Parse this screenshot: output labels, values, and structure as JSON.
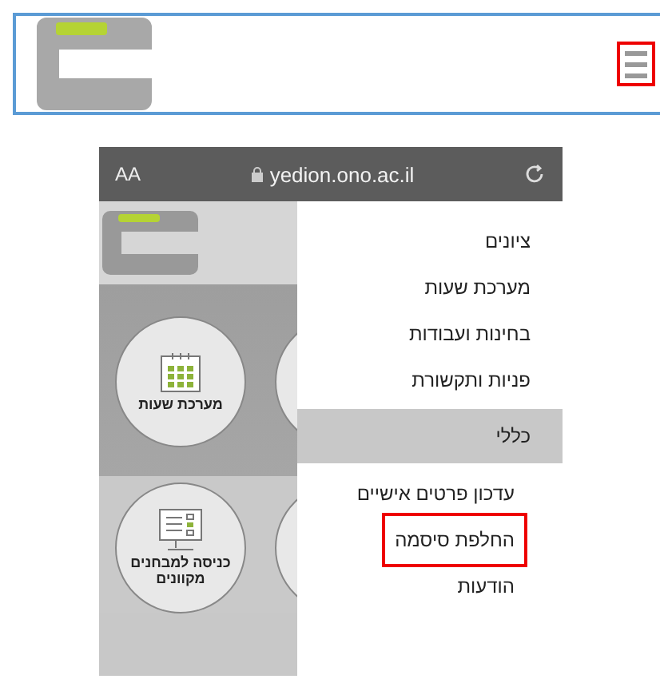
{
  "header": {
    "menu_button": {
      "outlined": true
    }
  },
  "browser": {
    "text_size_button": "AA",
    "url": "yedion.ono.ac.il"
  },
  "tiles": [
    {
      "label": "מערכת שעות",
      "kind": "calendar"
    },
    {
      "kind": "blank"
    },
    {
      "label": "כניסה למבחנים מקוונים",
      "kind": "exam"
    },
    {
      "kind": "blank"
    }
  ],
  "menu": [
    {
      "label": "ציונים",
      "selected": false,
      "outlined": false
    },
    {
      "label": "מערכת שעות",
      "selected": false,
      "outlined": false
    },
    {
      "label": "בחינות ועבודות",
      "selected": false,
      "outlined": false
    },
    {
      "label": "פניות ותקשורת",
      "selected": false,
      "outlined": false
    },
    {
      "label": "כללי",
      "selected": true,
      "outlined": false
    },
    {
      "label": "עדכון פרטים אישיים",
      "selected": false,
      "outlined": false
    },
    {
      "label": "החלפת סיסמה",
      "selected": false,
      "outlined": true
    },
    {
      "label": "הודעות",
      "selected": false,
      "outlined": false
    }
  ]
}
